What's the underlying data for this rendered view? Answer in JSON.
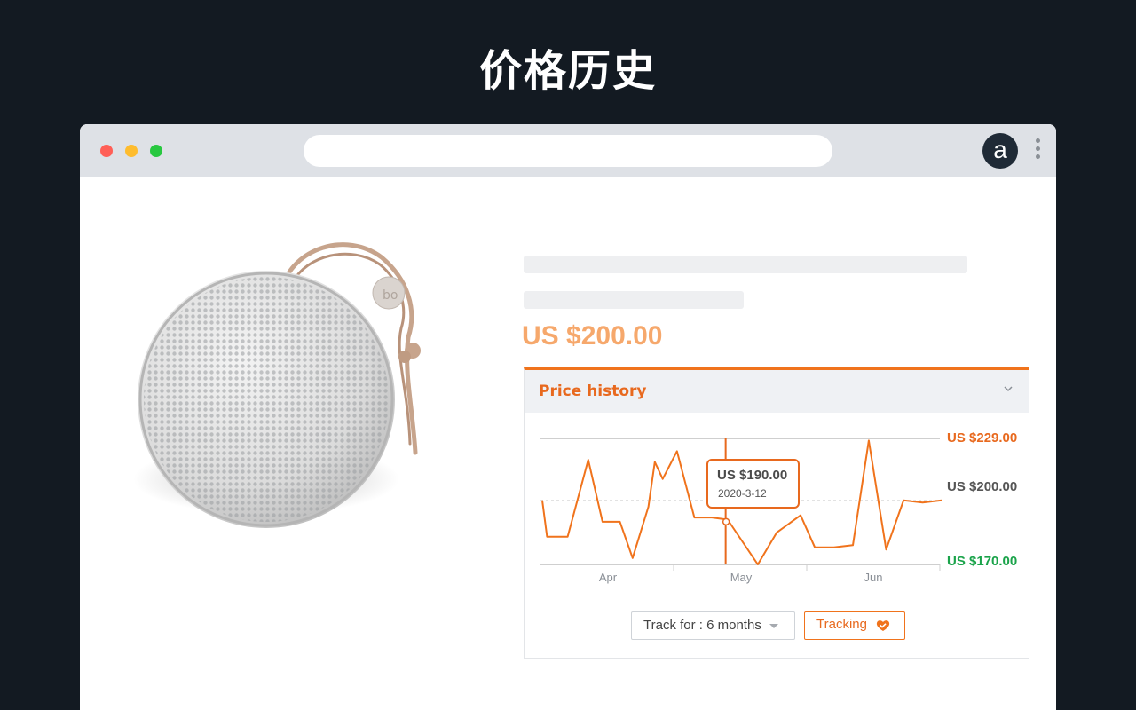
{
  "headline": "价格历史",
  "browser": {
    "address_value": "",
    "extension_icon": "a",
    "menu_icon": "kebab-menu-icon"
  },
  "product": {
    "price": "US $200.00"
  },
  "price_history": {
    "title": "Price history",
    "price_labels": {
      "high": "US $229.00",
      "current": "US $200.00",
      "low": "US $170.00"
    },
    "tooltip": {
      "price": "US $190.00",
      "date": "2020-3-12"
    },
    "months": [
      "Apr",
      "May",
      "Jun"
    ],
    "track_select": {
      "label": "Track for : 6 months"
    },
    "tracking_button": {
      "label": "Tracking"
    },
    "colors": {
      "accent": "#f0731c",
      "high": "#e8691e",
      "low": "#1aa34a",
      "current": "#555555"
    }
  },
  "chart_data": {
    "type": "line",
    "series": [
      {
        "points": [
          [
            0,
            200
          ],
          [
            3,
            183
          ],
          [
            16,
            183
          ],
          [
            29,
            219
          ],
          [
            38,
            190
          ],
          [
            49,
            190
          ],
          [
            57,
            173
          ],
          [
            67,
            197
          ],
          [
            71,
            218
          ],
          [
            76,
            210
          ],
          [
            85,
            223
          ],
          [
            96,
            192
          ],
          [
            107,
            192
          ],
          [
            117,
            191
          ],
          [
            136,
            170
          ],
          [
            148,
            185
          ],
          [
            163,
            193
          ],
          [
            172,
            178
          ],
          [
            184,
            178
          ],
          [
            196,
            179
          ],
          [
            206,
            228
          ],
          [
            217,
            177
          ],
          [
            228,
            200
          ],
          [
            240,
            199
          ],
          [
            252,
            200
          ]
        ]
      }
    ],
    "ylim": [
      170,
      229
    ],
    "x_ticks": [
      "Apr",
      "May",
      "Jun"
    ],
    "reference_line": 200,
    "highlight": {
      "x": 116,
      "y": 190,
      "label": "US $190.00",
      "date": "2020-3-12"
    }
  }
}
